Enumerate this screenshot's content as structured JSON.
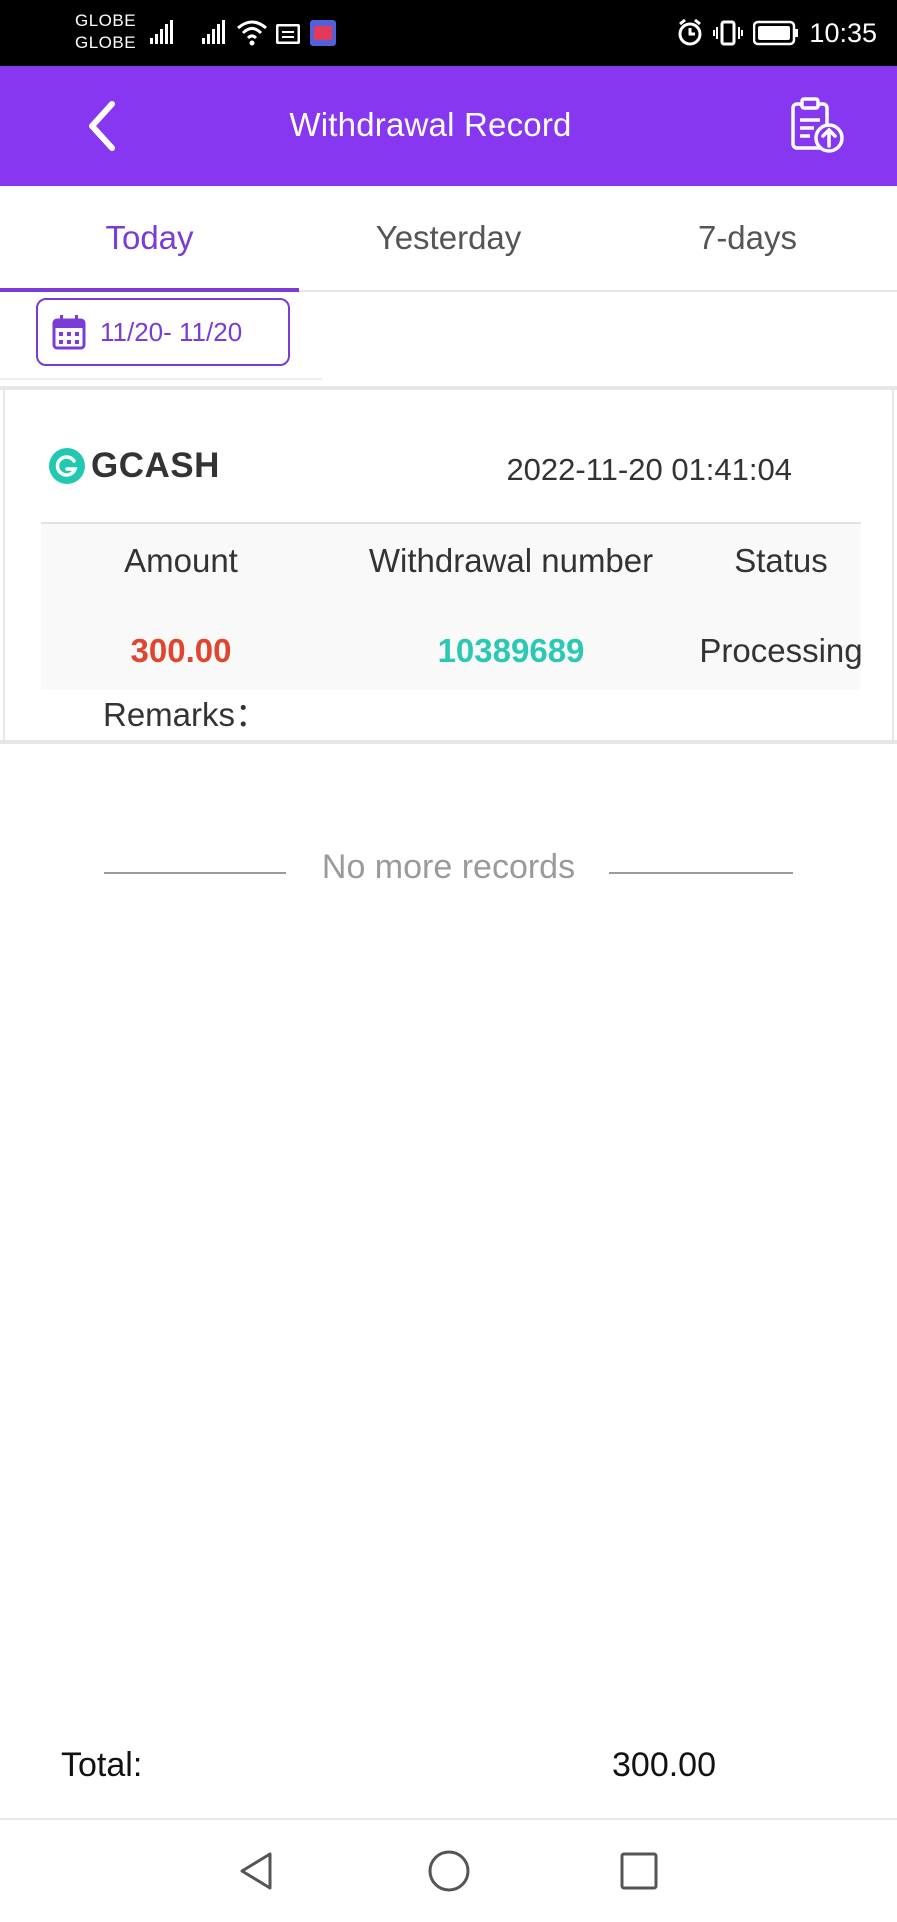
{
  "status_bar": {
    "carrier_1": "GLOBE",
    "carrier_2": "GLOBE",
    "time": "10:35"
  },
  "header": {
    "title": "Withdrawal Record",
    "back_icon": "chevron-left-icon",
    "action_icon": "clipboard-upload-icon"
  },
  "tabs": [
    {
      "label": "Today",
      "active": true
    },
    {
      "label": "Yesterday",
      "active": false
    },
    {
      "label": "7-days",
      "active": false
    }
  ],
  "date_filter": {
    "range": "11/20- 11/20",
    "icon": "calendar-icon"
  },
  "records": [
    {
      "channel": "GCASH",
      "datetime": "2022-11-20 01:41:04",
      "columns": {
        "amount": "Amount",
        "number": "Withdrawal number",
        "status": "Status"
      },
      "amount": "300.00",
      "withdrawal_number": "10389689",
      "status": "Processing",
      "remarks_label": "Remarks："
    }
  ],
  "end_message": "No more records",
  "footer": {
    "total_label": "Total:",
    "total_value": "300.00"
  },
  "colors": {
    "header_bg": "#8737f0",
    "accent": "#7a3bd6",
    "amount": "#e0452f",
    "withdrawal_number": "#2ac8b5",
    "gcash": "#22c9b0"
  }
}
